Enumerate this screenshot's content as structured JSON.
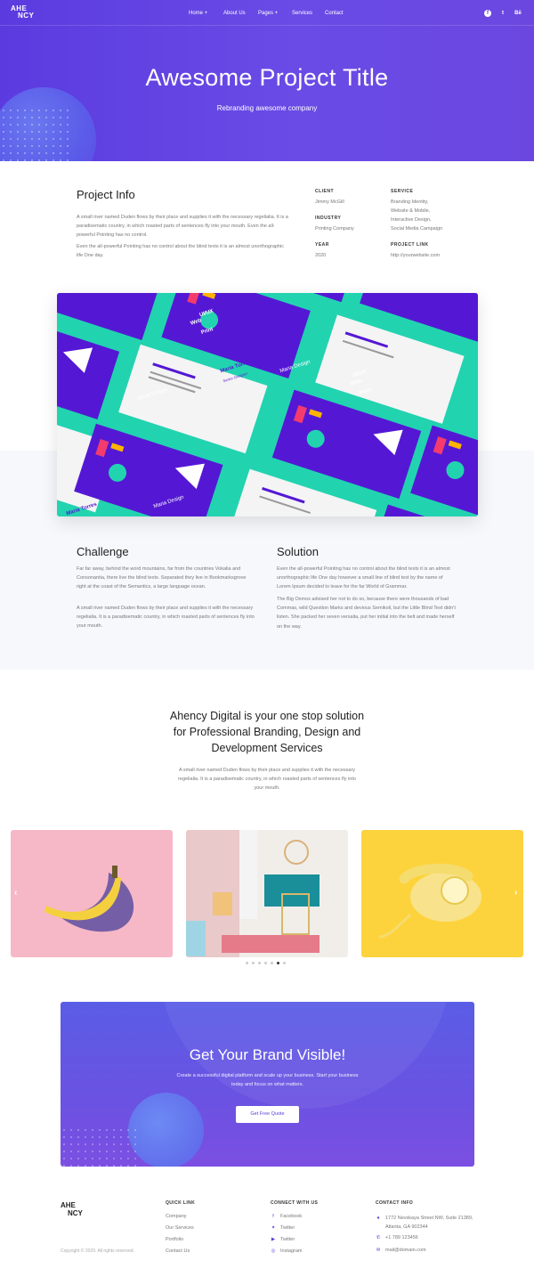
{
  "brand": {
    "logo_line1": "AHE",
    "logo_line2": "NCY"
  },
  "nav": [
    {
      "label": "Home +"
    },
    {
      "label": "About Us"
    },
    {
      "label": "Pages +"
    },
    {
      "label": "Services"
    },
    {
      "label": "Contact"
    }
  ],
  "social": [
    {
      "icon": "facebook-icon",
      "glyph": "f"
    },
    {
      "icon": "twitter-icon",
      "glyph": "t"
    },
    {
      "icon": "behance-icon",
      "glyph": "Bē"
    }
  ],
  "hero": {
    "title": "Awesome Project Title",
    "subtitle": "Rebranding awesome company"
  },
  "project": {
    "heading": "Project Info",
    "para1": "A small river named Duden flows by their place and supplies it with the necessary regelialia. It is a paradisematic country, in which roasted parts of sentences fly into your mouth. Even the all-powerful Pointing has no control.",
    "para2": "Even the all-powerful Pointing has no control about the blind texts it is an almost unorthographic life One day.",
    "client_label": "CLIENT",
    "client_value": "Jimmy McGill",
    "industry_label": "INDUSTRY",
    "industry_value": "Printing Company",
    "year_label": "YEAR",
    "year_value": "2020",
    "service_label": "SERVICE",
    "service_values": [
      "Branding Identity,",
      "Website & Mobile,",
      "Interactive Design,",
      "Social Media Campaign"
    ],
    "link_label": "PROJECT LINK",
    "link_value": "http://yourwebsite.com"
  },
  "mockup": {
    "card_name": "Maria Torres",
    "card_role": "Senior Designer",
    "card_brand": "Maria Design",
    "card_tag1": "UI/UX",
    "card_tag2": "Web",
    "card_tag3": "Print"
  },
  "challenge": {
    "heading": "Challenge",
    "para1": "Far far away, behind the word mountains, far from the countries Vokalia and Consonantia, there live the blind texts. Separated they live in Bookmarksgrove right at the coast of the Semantics, a large language ocean.",
    "para2": "A small river named Duden flows by their place and supplies it with the necessary regelialia. It is a paradisematic country, in which roasted parts of sentences fly into your mouth."
  },
  "solution": {
    "heading": "Solution",
    "para1": "Even the all-powerful Pointing has no control about the blind texts it is an almost unorthographic life One day however a small line of blind text by the name of Lorem Ipsum decided to leave for the far World of Grammar.",
    "para2": "The Big Oxmox advised her not to do so, because there were thousands of bad Commas, wild Question Marks and devious Semikoli, but the Little Blind Text didn't listen. She packed her seven versalia, put her initial into the belt and made herself on the way."
  },
  "intro": {
    "line1": "Ahency Digital is your one stop solution",
    "line2": "for Professional Branding, Design and",
    "line3": "Development Services",
    "text": "A small river named Duden flows by their place and supplies it with the necessary regelialia. It is a paradisematic country, in which roasted parts of sentences fly into your mouth."
  },
  "carousel": {
    "dots": 7,
    "active_index": 5,
    "prev": "‹",
    "next": "›"
  },
  "cta": {
    "title": "Get Your Brand Visible!",
    "text": "Create a successful digital platform and scale up your business. Start your business today and focus on what matters.",
    "button": "Get Free Quote"
  },
  "footer": {
    "logo_line1": "AHE",
    "logo_line2": "NCY",
    "copyright": "Copyright © 2020. All rights reserved.",
    "quick_title": "QUICK LINK",
    "quick_links": [
      "Company",
      "Our Services",
      "Portfolio",
      "Contact Us"
    ],
    "connect_title": "CONNECT WITH US",
    "connect": [
      {
        "label": "Facebook",
        "icon": "facebook-icon"
      },
      {
        "label": "Twitter",
        "icon": "twitter-icon"
      },
      {
        "label": "Twitter",
        "icon": "youtube-icon"
      },
      {
        "label": "Instagram",
        "icon": "instagram-icon"
      }
    ],
    "contact_title": "CONTACT INFO",
    "address1": "1772 Nevskaya Street NW, Suite 21389,",
    "address2": "Atlanta, GA 902344",
    "phone": "+1 789 123456",
    "email": "mail@domain.com"
  },
  "colors": {
    "primary": "#5b3bdf",
    "teal": "#22d3b0",
    "pink": "#f6b7c7",
    "yellow": "#fdd33d"
  }
}
